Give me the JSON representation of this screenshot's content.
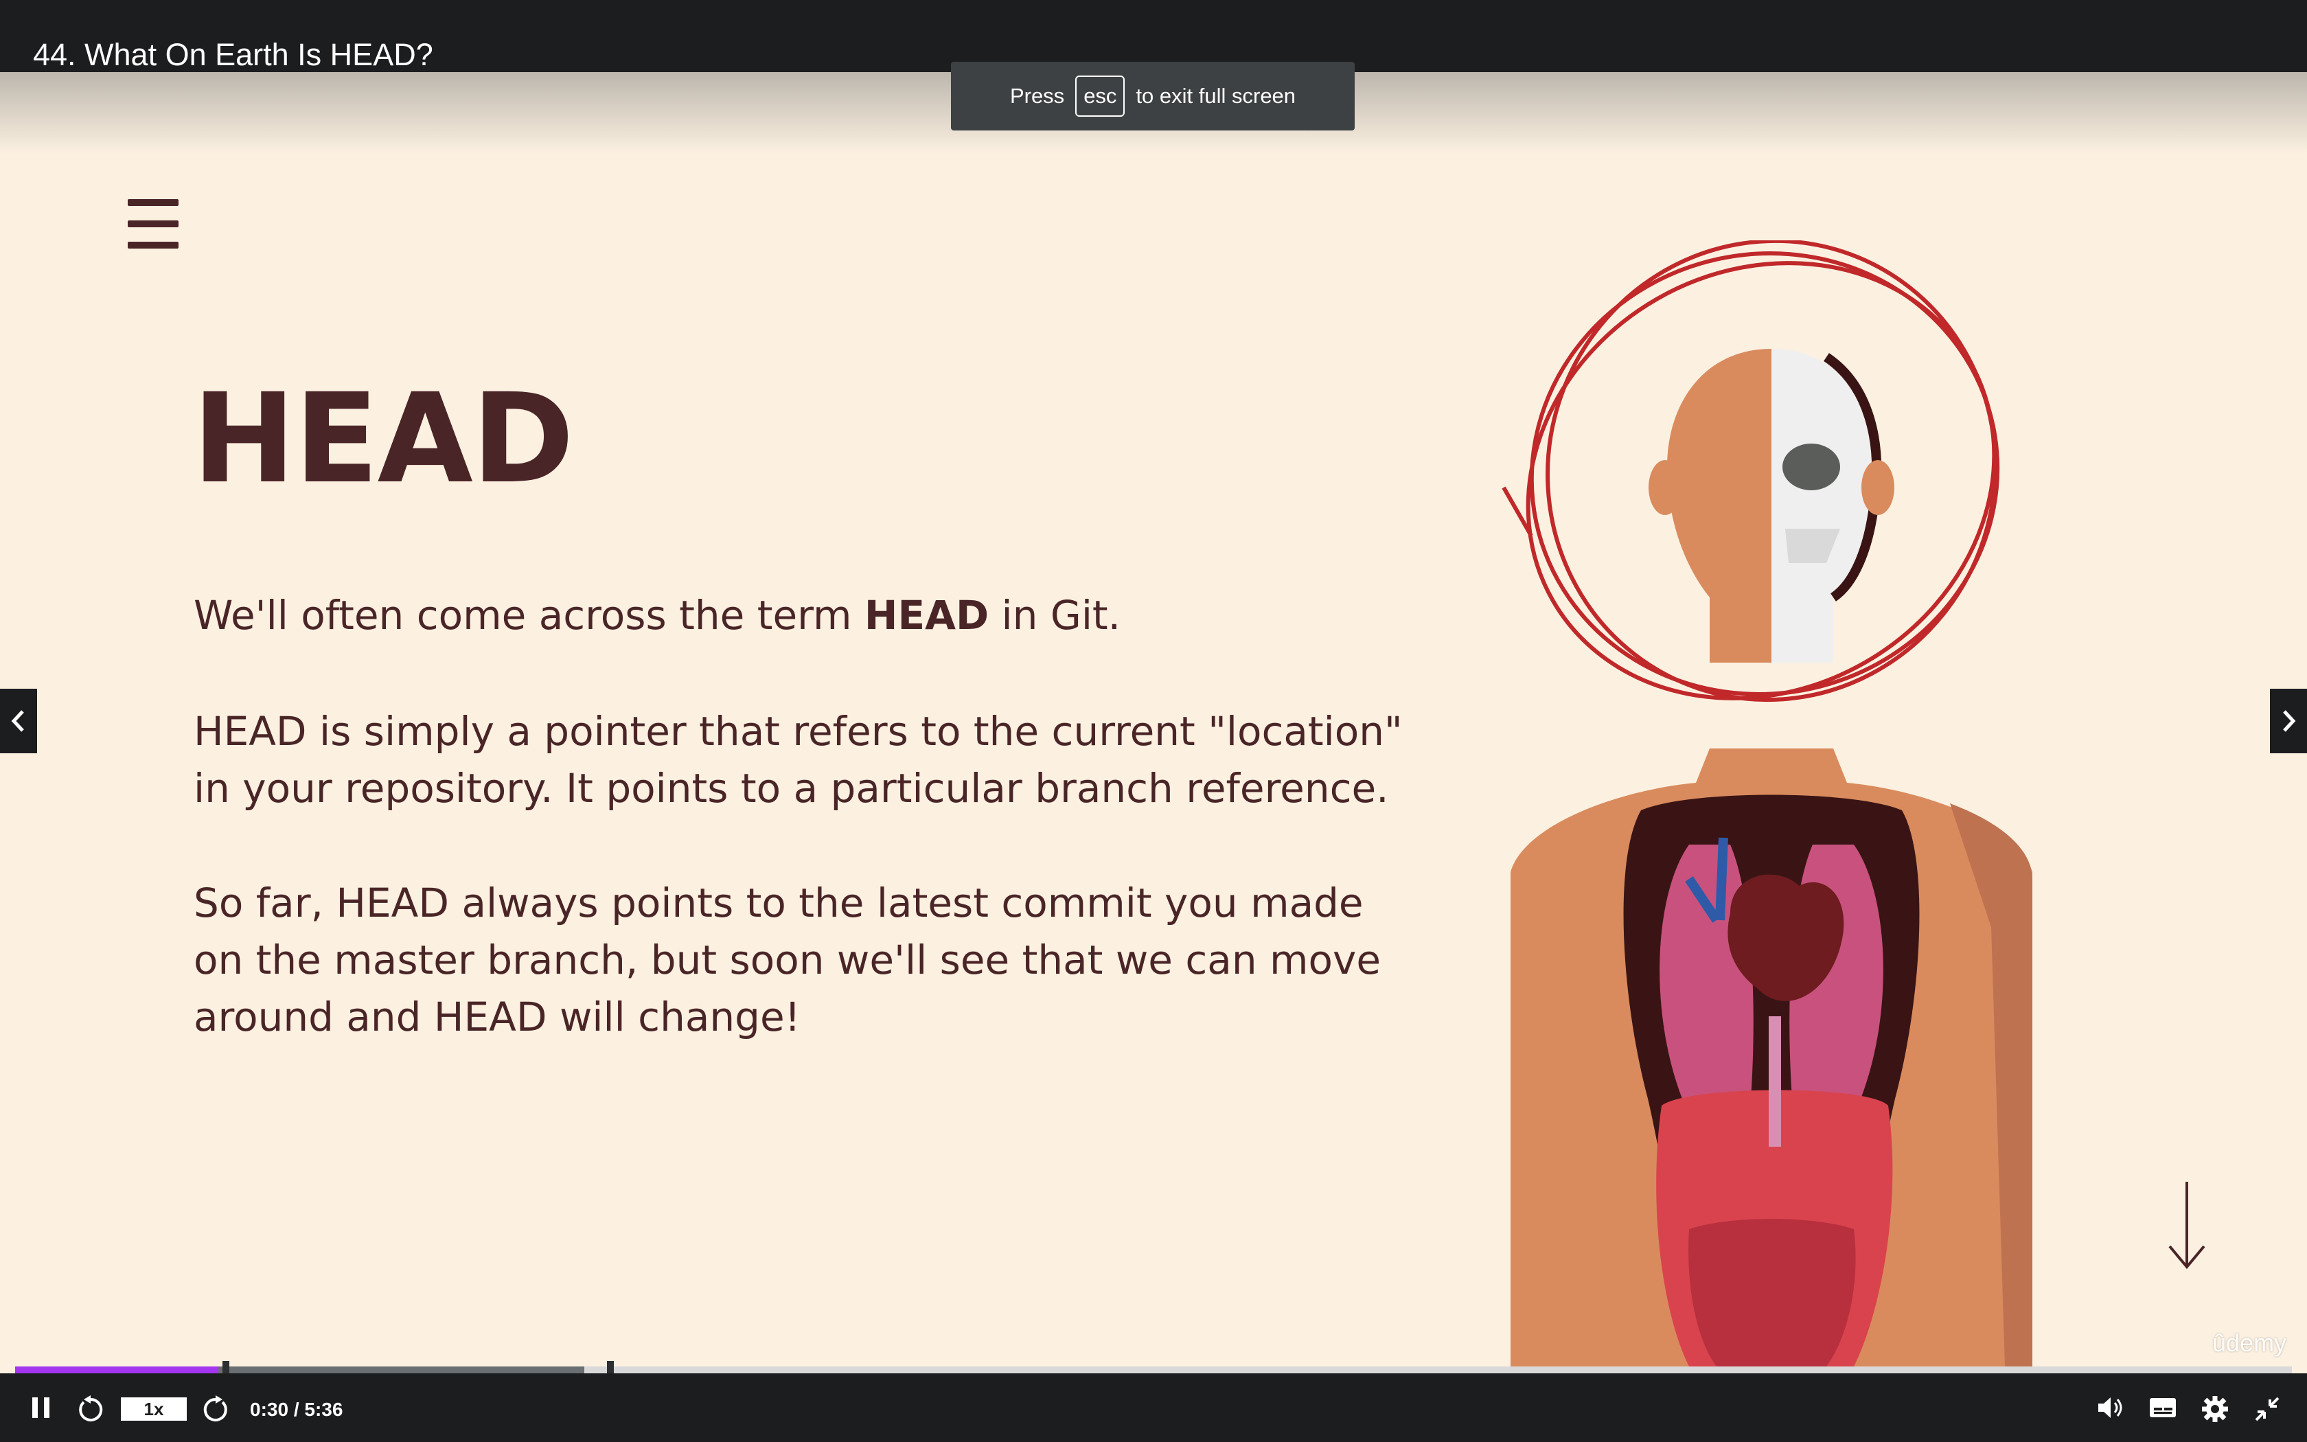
{
  "window": {
    "title": "44. What On Earth Is HEAD?"
  },
  "fullscreen_notice": {
    "before": "Press",
    "key": "esc",
    "after": "to exit full screen"
  },
  "slide": {
    "heading": "HEAD",
    "p1_pre": "We'll often come across the term ",
    "p1_bold": "HEAD",
    "p1_post": " in Git.",
    "p2": "HEAD is simply a pointer that refers to the current \"location\" in your repository.   It points to a particular branch reference.",
    "p3": "So far, HEAD always points to the latest commit you made on the master branch, but soon we'll see that we can move around and HEAD will change!",
    "watermark": "ûdemy"
  },
  "player": {
    "speed": "1x",
    "time": "0:30 / 5:36",
    "progress_played_fraction": 0.0893,
    "buffered_fraction": 0.25
  },
  "icons": {
    "menu": "hamburger-icon",
    "prev": "chevron-left-icon",
    "next": "chevron-right-icon",
    "play_pause": "pause-icon",
    "rewind": "rewind-5-icon",
    "forward": "forward-5-icon",
    "volume": "volume-icon",
    "captions": "captions-icon",
    "settings": "gear-icon",
    "exit_fullscreen": "exit-fullscreen-icon"
  },
  "colors": {
    "accent": "#a435f0",
    "slide_bg": "#fcf1e1",
    "text": "#4a2527",
    "bar": "#1c1d1f"
  }
}
